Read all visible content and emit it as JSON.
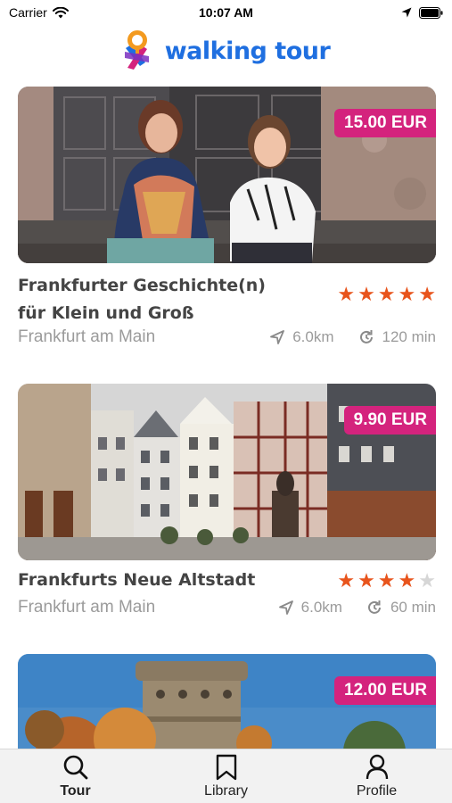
{
  "status_bar": {
    "carrier": "Carrier",
    "time": "10:07 AM"
  },
  "header": {
    "brand_name": "walking tour",
    "icon": "walking-tour-logo"
  },
  "tours": [
    {
      "price": "15.00 EUR",
      "title_line1": "Frankfurter Geschichte(n)",
      "title_line2": "für Klein und Groß",
      "location": "Frankfurt am Main",
      "distance": "6.0km",
      "duration": "120 min",
      "rating": 5,
      "image": "two-women-sitting-by-ornate-door"
    },
    {
      "price": "9.90 EUR",
      "title": "Frankfurts Neue Altstadt",
      "location": "Frankfurt am Main",
      "distance": "6.0km",
      "duration": "60 min",
      "rating": 4,
      "image": "old-town-square-half-timbered-houses"
    },
    {
      "price": "12.00 EUR",
      "image": "round-stone-tower-autumn-trees"
    }
  ],
  "tab_bar": {
    "tabs": [
      {
        "label": "Tour",
        "icon": "search-icon",
        "active": true
      },
      {
        "label": "Library",
        "icon": "bookmark-icon",
        "active": false
      },
      {
        "label": "Profile",
        "icon": "person-icon",
        "active": false
      }
    ]
  },
  "colors": {
    "brand_blue": "#1f6fe0",
    "price_magenta": "#d4237d",
    "star_orange": "#e8541c",
    "star_empty": "#d6d6d6",
    "muted_text": "#9b9b9b"
  }
}
